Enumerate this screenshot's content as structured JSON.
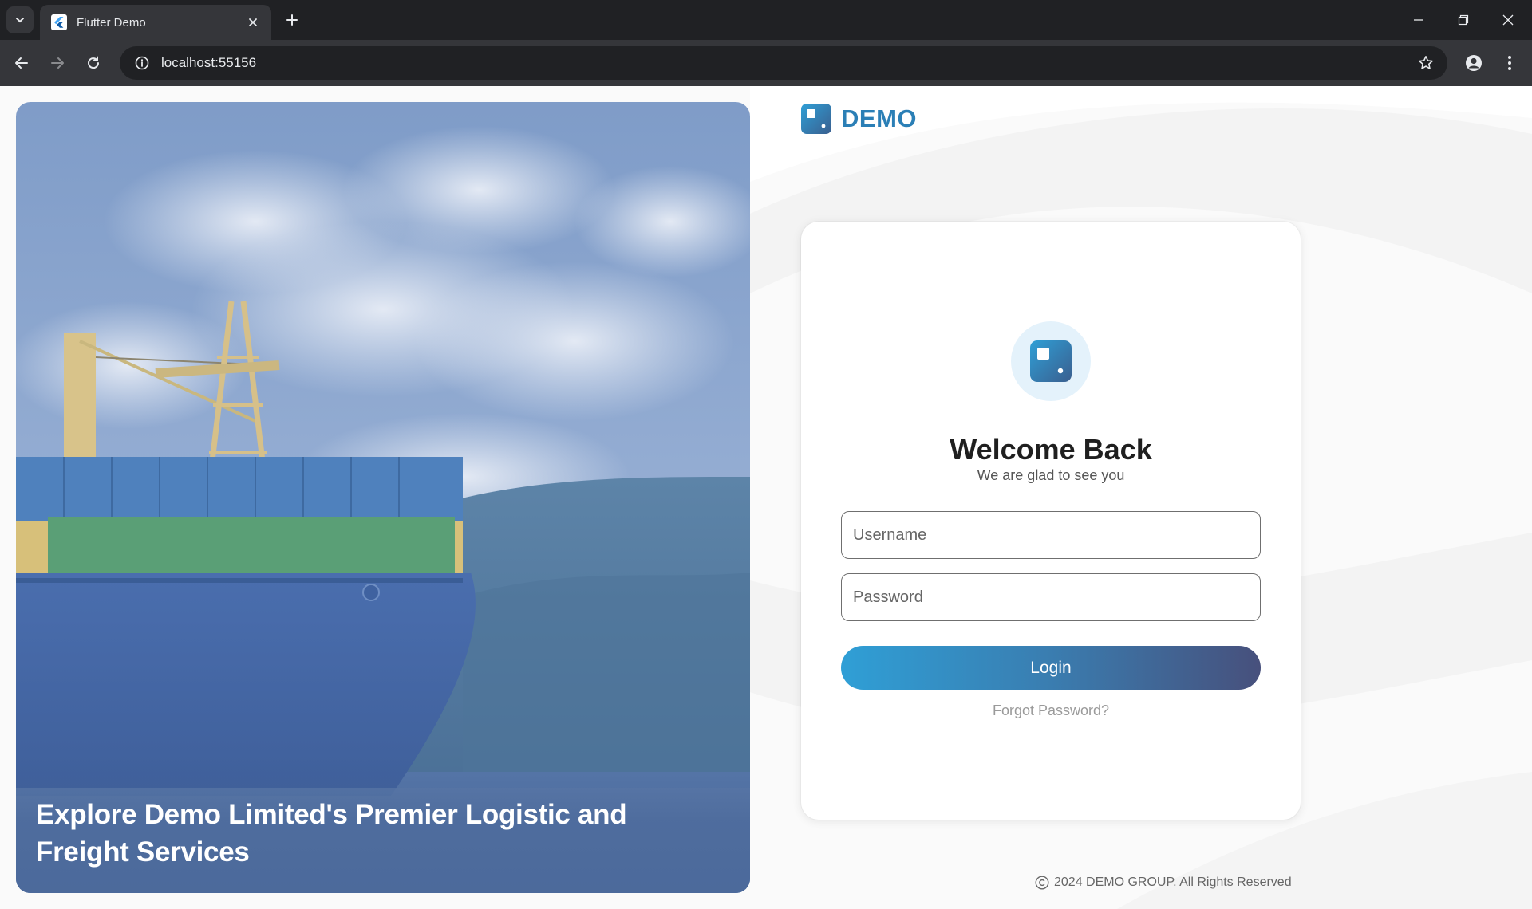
{
  "browser": {
    "tab_title": "Flutter Demo",
    "url": "localhost:55156",
    "icons": {
      "tab_menu": "chevron-down-icon",
      "favicon": "flutter-icon",
      "tab_close": "close-icon",
      "new_tab": "plus-icon",
      "back": "arrow-left-icon",
      "forward": "arrow-right-icon",
      "reload": "reload-icon",
      "site_info": "info-icon",
      "bookmark": "star-icon",
      "profile": "person-icon",
      "menu": "kebab-menu-icon",
      "minimize": "minimize-icon",
      "restore": "restore-icon",
      "close_window": "close-icon"
    }
  },
  "hero": {
    "title": "Explore Demo Limited's Premier Logistic and Freight Services"
  },
  "brand": {
    "name": "DEMO",
    "color": "#2b7fb6"
  },
  "login": {
    "title": "Welcome Back",
    "subtitle": "We are glad to see you",
    "username_placeholder": "Username",
    "password_placeholder": "Password",
    "login_label": "Login",
    "forgot_label": "Forgot Password?",
    "button_gradient": [
      "#2f9fd6",
      "#47507c"
    ]
  },
  "footer": {
    "copyright": "2024 DEMO GROUP. All Rights Reserved"
  }
}
